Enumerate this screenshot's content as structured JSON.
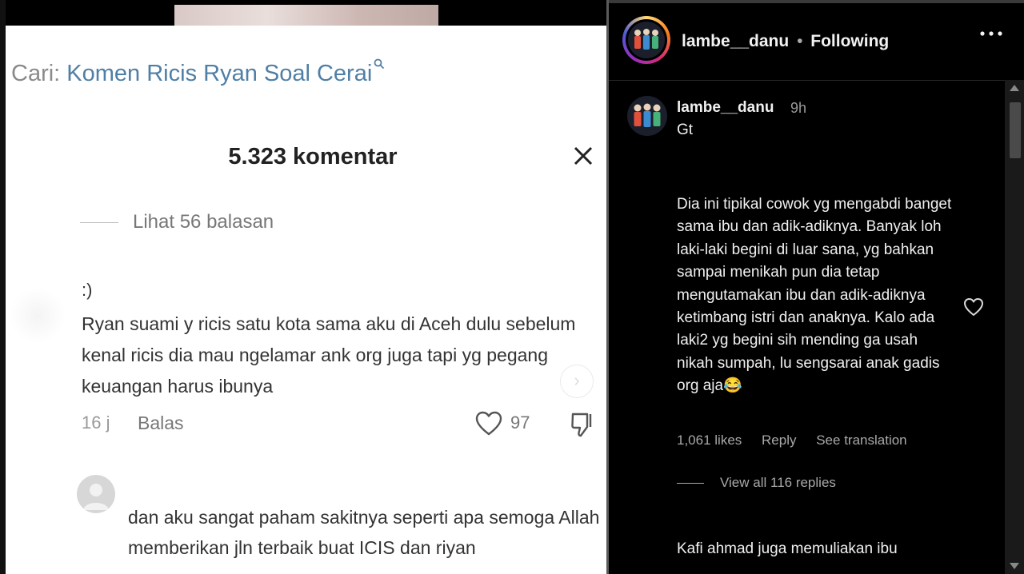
{
  "tiktok": {
    "search_prefix": "Cari:",
    "search_query": "Komen Ricis Ryan Soal Cerai",
    "comment_count": "5.323 komentar",
    "view_replies": "Lihat 56 balasan",
    "comment1": {
      "username": ":)",
      "text": "Ryan suami y ricis satu kota sama aku di Aceh dulu sebelum kenal ricis dia mau ngelamar ank org juga tapi yg pegang keuangan harus ibunya",
      "time": "16 j",
      "reply_label": "Balas",
      "likes": "97"
    },
    "comment2": {
      "text": "dan aku sangat paham sakitnya seperti apa semoga Allah memberikan jln terbaik buat ICIS dan riyan"
    }
  },
  "instagram": {
    "username": "lambe__danu",
    "separator": "•",
    "follow_status": "Following",
    "caption": {
      "username": "lambe__danu",
      "time": "9h",
      "text": "Gt"
    },
    "comment": {
      "text": "Dia ini tipikal cowok yg mengabdi banget sama ibu dan adik-adiknya. Banyak loh laki-laki begini di luar sana, yg bahkan sampai menikah pun dia tetap mengutamakan ibu dan adik-adiknya ketimbang istri dan anaknya. Kalo ada laki2 yg begini sih mending ga usah nikah sumpah, lu sengsarai anak gadis org aja😂",
      "likes": "1,061 likes",
      "reply_label": "Reply",
      "translation_label": "See translation",
      "view_replies": "View all 116 replies"
    },
    "next_comment_text": "Kafi ahmad juga memuliakan ibu"
  }
}
